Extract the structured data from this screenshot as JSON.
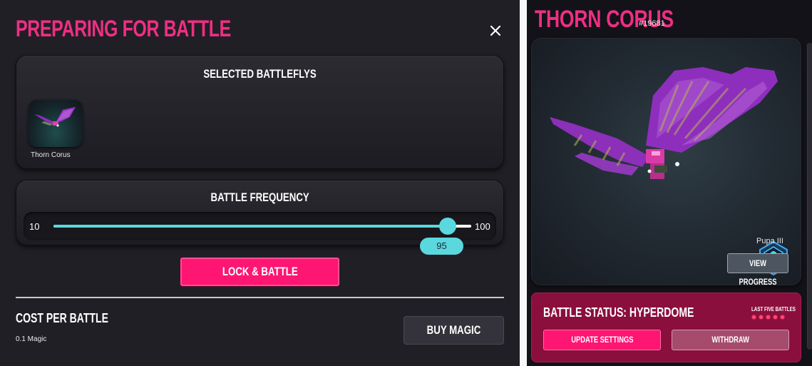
{
  "modal": {
    "title": "PREPARING FOR BATTLE",
    "selected": {
      "title": "SELECTED BATTLEFLYS",
      "items": [
        {
          "name": "Thorn Corus"
        }
      ]
    },
    "frequency": {
      "title": "BATTLE FREQUENCY",
      "min_label": "10",
      "max_label": "100",
      "min": 10,
      "max": 100,
      "value": 95,
      "value_label": "95"
    },
    "lock_button": "LOCK & BATTLE",
    "cost": {
      "title": "COST PER BATTLE",
      "value": "0.1 Magic"
    },
    "buy_button": "BUY MAGIC"
  },
  "detail": {
    "name": "THORN CORUS",
    "id": "#19681",
    "rank_label": "Pupa III",
    "view_progress_button": "VIEW PROGRESS",
    "status_title": "BATTLE STATUS: HYPERDOME",
    "last_five_label": "LAST FIVE BATTLES",
    "update_button": "UPDATE SETTINGS",
    "withdraw_button": "WITHDRAW"
  },
  "colors": {
    "accent_pink": "#ee2f83",
    "button_pink": "#fe1672",
    "slider_teal": "#5ad8de",
    "status_card": "#8a0f3c"
  }
}
